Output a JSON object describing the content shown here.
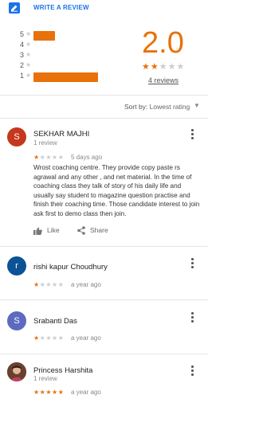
{
  "header": {
    "write_review_label": "WRITE A REVIEW",
    "icon": "edit-icon",
    "accent": "#1a73e8"
  },
  "summary": {
    "average": "2.0",
    "average_value": 2.0,
    "reviews_link": "4 reviews",
    "histogram": [
      {
        "stars": "5",
        "count": 1
      },
      {
        "stars": "4",
        "count": 0
      },
      {
        "stars": "3",
        "count": 0
      },
      {
        "stars": "2",
        "count": 0
      },
      {
        "stars": "1",
        "count": 3
      }
    ],
    "bar_color": "#e8710a"
  },
  "sort": {
    "label": "Sort by:",
    "value": "Lowest rating"
  },
  "reviews": [
    {
      "initial": "S",
      "avatar_color": "#c5381d",
      "name": "SEKHAR MAJHI",
      "sub": "1 review",
      "rating": 1,
      "time": "5 days ago",
      "text": "Wrost coaching centre. They provide copy paste rs agrawal and any other , and net material. In the time of coaching class they talk of story of his daily life and usually say student to magazine question practise and finish their coaching time. Those candidate interest to join ask first to demo class then join.",
      "like_label": "Like",
      "share_label": "Share"
    },
    {
      "initial": "r",
      "avatar_color": "#0b5394",
      "name": "rishi kapur Choudhury",
      "sub": "",
      "rating": 1,
      "time": "a year ago"
    },
    {
      "initial": "S",
      "avatar_color": "#5c6bc0",
      "name": "Srabanti Das",
      "sub": "",
      "rating": 1,
      "time": "a year ago"
    },
    {
      "initial": "",
      "avatar_color": "#7a4b3a",
      "name": "Princess Harshita",
      "sub": "1 review",
      "rating": 5,
      "time": "a year ago"
    }
  ]
}
